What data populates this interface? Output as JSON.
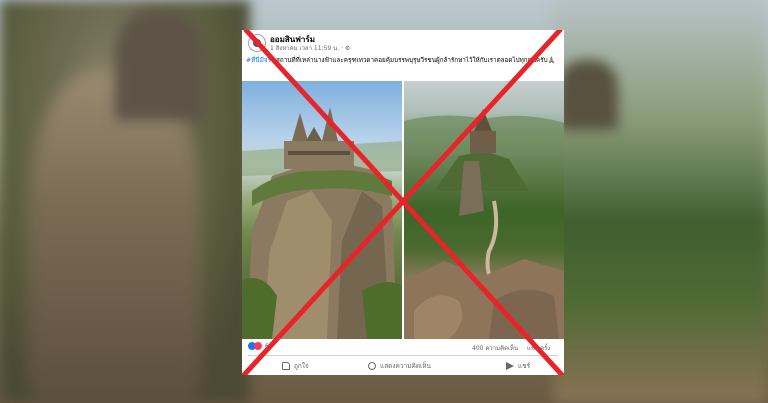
{
  "post": {
    "page_name": "ออมสินฟาร์ม",
    "meta": "1 สิงหาคม เวลา 11:59 น. · ⚙",
    "hashtag": "#ที่นี่มีจริง",
    "body_text": " สถานที่ที่เหล่านางฟ้าและครุฑเทวดาคอยคุ้มบรรพบุรุษวีรชนผู้กล้ารักษาไว้ให้กับเราตลอดไปทุกคนครับ🙏🏽",
    "reaction_count": "6",
    "comment_count": "400 ความคิดเห็น",
    "share_count": "แชร์ ครั้ง",
    "actions": {
      "like": "ถูกใจ",
      "comment": "แสดงความคิดเห็น",
      "share": "แชร์"
    }
  },
  "overlay": {
    "cross_color": "#e8232a"
  }
}
